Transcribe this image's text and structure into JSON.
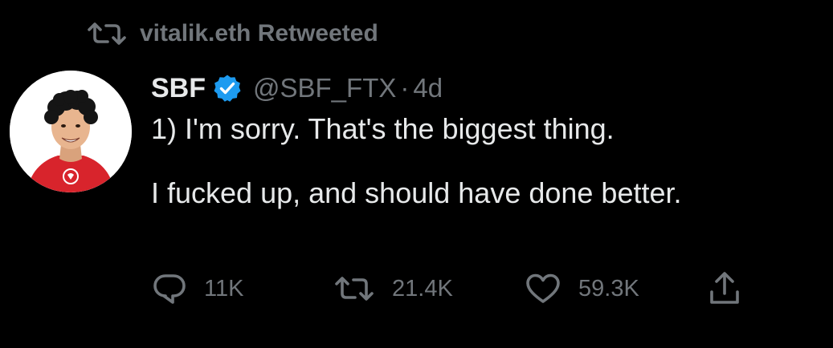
{
  "retweet_context": {
    "icon": "retweet-icon",
    "text": "vitalik.eth Retweeted"
  },
  "tweet": {
    "author": {
      "display_name": "SBF",
      "verified_icon": "verified-badge-icon",
      "handle": "@SBF_FTX",
      "avatar": "avatar"
    },
    "separator": "·",
    "timestamp": "4d",
    "text_lines": [
      "1) I'm sorry.  That's the biggest thing.",
      "",
      "I fucked up, and should have done better."
    ]
  },
  "actions": {
    "reply": {
      "icon": "reply-icon",
      "count": "11K"
    },
    "retweet": {
      "icon": "retweet-icon",
      "count": "21.4K"
    },
    "like": {
      "icon": "heart-icon",
      "count": "59.3K"
    },
    "share": {
      "icon": "share-icon"
    }
  },
  "colors": {
    "background": "#000000",
    "primary_text": "#e7e9ea",
    "secondary_text": "#71767b",
    "verified_blue": "#1d9bf0",
    "avatar_shirt": "#d8242c"
  }
}
